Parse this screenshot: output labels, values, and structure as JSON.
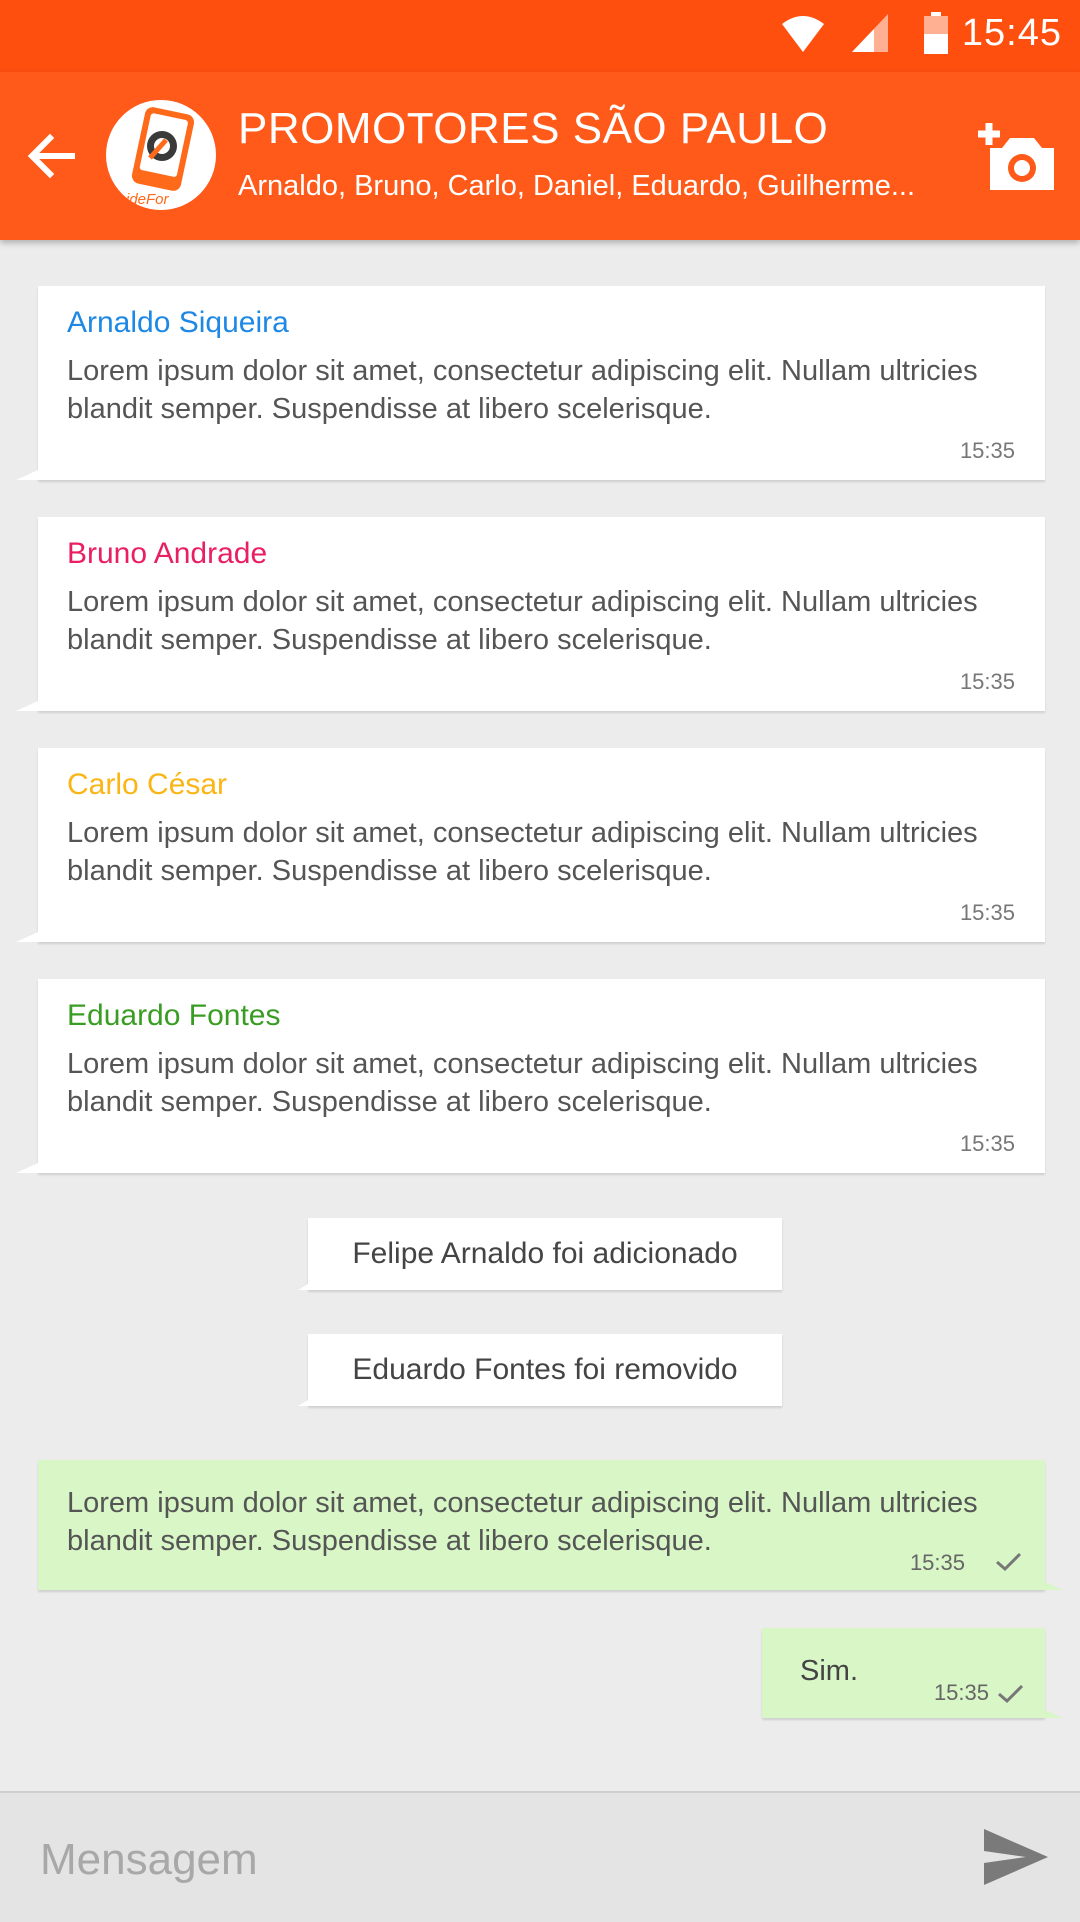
{
  "status_bar": {
    "time": "15:45"
  },
  "header": {
    "title": "PROMOTORES SÃO PAULO",
    "subtitle": "Arnaldo, Bruno, Carlo, Daniel, Eduardo, Guilherme...",
    "logo_text": "ideFor"
  },
  "colors": {
    "status_bar": "#ff4f0f",
    "app_bar": "#ff5a1a",
    "background": "#ececec",
    "outgoing_bubble": "#d8f6c6",
    "sender_arnaldo": "#1e88e5",
    "sender_bruno": "#e91e63",
    "sender_carlo": "#fbb515",
    "sender_eduardo": "#3a9d23"
  },
  "messages": [
    {
      "sender": "Arnaldo Siqueira",
      "text": "Lorem ipsum dolor sit amet, consectetur adipiscing elit. Nullam ultricies blandit semper. Suspendisse at libero scelerisque.",
      "time": "15:35"
    },
    {
      "sender": "Bruno Andrade",
      "text": "Lorem ipsum dolor sit amet, consectetur adipiscing elit. Nullam ultricies blandit semper. Suspendisse at libero scelerisque.",
      "time": "15:35"
    },
    {
      "sender": "Carlo César",
      "text": "Lorem ipsum dolor sit amet, consectetur adipiscing elit. Nullam ultricies blandit semper. Suspendisse at libero scelerisque.",
      "time": "15:35"
    },
    {
      "sender": "Eduardo Fontes",
      "text": "Lorem ipsum dolor sit amet, consectetur adipiscing elit. Nullam ultricies blandit semper. Suspendisse at libero scelerisque.",
      "time": "15:35"
    }
  ],
  "system_messages": [
    "Felipe Arnaldo foi adicionado",
    "Eduardo Fontes foi removido"
  ],
  "outgoing": [
    {
      "text": "Lorem ipsum dolor sit amet, consectetur adipiscing elit. Nullam ultricies blandit semper. Suspendisse at libero scelerisque.",
      "time": "15:35"
    },
    {
      "text": "Sim.",
      "time": "15:35"
    }
  ],
  "composer": {
    "placeholder": "Mensagem"
  },
  "icons": {
    "back": "arrow-back-icon",
    "camera": "add-camera-icon",
    "send": "send-icon",
    "wifi": "wifi-icon",
    "signal": "signal-icon",
    "battery": "battery-icon",
    "read": "check-icon"
  }
}
